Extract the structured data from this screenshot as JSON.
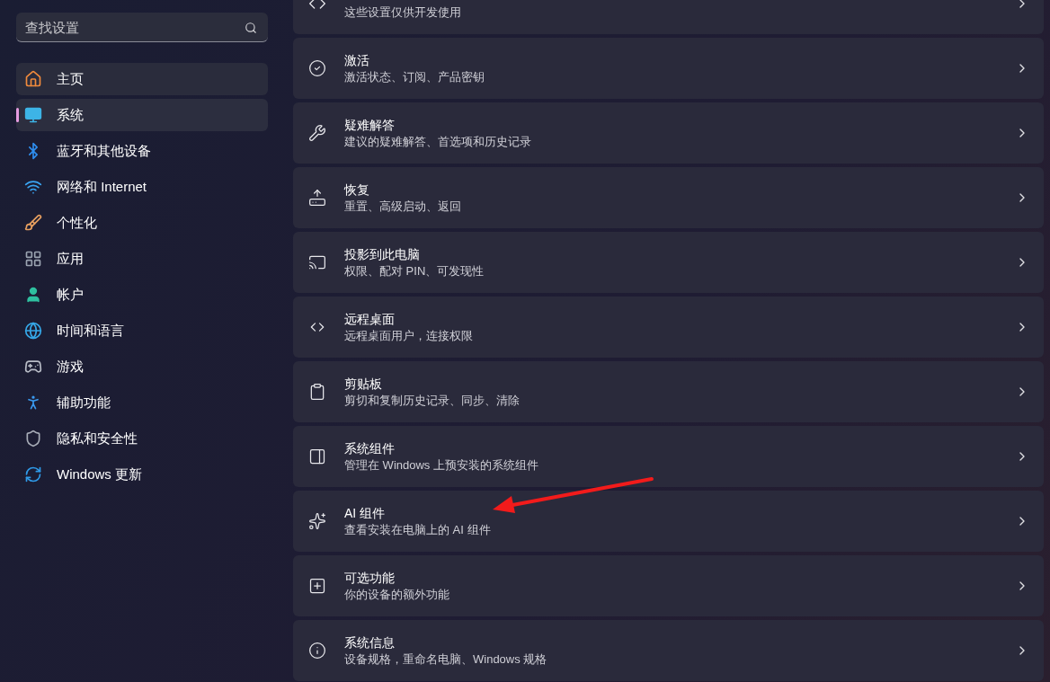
{
  "sidebar": {
    "search": {
      "placeholder": "查找设置"
    },
    "items": [
      {
        "label": "主页",
        "selected": false,
        "hovered": true
      },
      {
        "label": "系统",
        "selected": true,
        "hovered": false
      },
      {
        "label": "蓝牙和其他设备",
        "selected": false,
        "hovered": false
      },
      {
        "label": "网络和 Internet",
        "selected": false,
        "hovered": false
      },
      {
        "label": "个性化",
        "selected": false,
        "hovered": false
      },
      {
        "label": "应用",
        "selected": false,
        "hovered": false
      },
      {
        "label": "帐户",
        "selected": false,
        "hovered": false
      },
      {
        "label": "时间和语言",
        "selected": false,
        "hovered": false
      },
      {
        "label": "游戏",
        "selected": false,
        "hovered": false
      },
      {
        "label": "辅助功能",
        "selected": false,
        "hovered": false
      },
      {
        "label": "隐私和安全性",
        "selected": false,
        "hovered": false
      },
      {
        "label": "Windows 更新",
        "selected": false,
        "hovered": false
      }
    ]
  },
  "settings": [
    {
      "subtitle": "这些设置仅供开发使用"
    },
    {
      "title": "激活",
      "subtitle": "激活状态、订阅、产品密钥"
    },
    {
      "title": "疑难解答",
      "subtitle": "建议的疑难解答、首选项和历史记录"
    },
    {
      "title": "恢复",
      "subtitle": "重置、高级启动、返回"
    },
    {
      "title": "投影到此电脑",
      "subtitle": "权限、配对 PIN、可发现性"
    },
    {
      "title": "远程桌面",
      "subtitle": "远程桌面用户，连接权限"
    },
    {
      "title": "剪贴板",
      "subtitle": "剪切和复制历史记录、同步、清除"
    },
    {
      "title": "系统组件",
      "subtitle": "管理在 Windows 上预安装的系统组件"
    },
    {
      "title": "AI 组件",
      "subtitle": "查看安装在电脑上的 AI 组件"
    },
    {
      "title": "可选功能",
      "subtitle": "你的设备的额外功能"
    },
    {
      "title": "系统信息",
      "subtitle": "设备规格，重命名电脑、Windows 规格"
    }
  ]
}
